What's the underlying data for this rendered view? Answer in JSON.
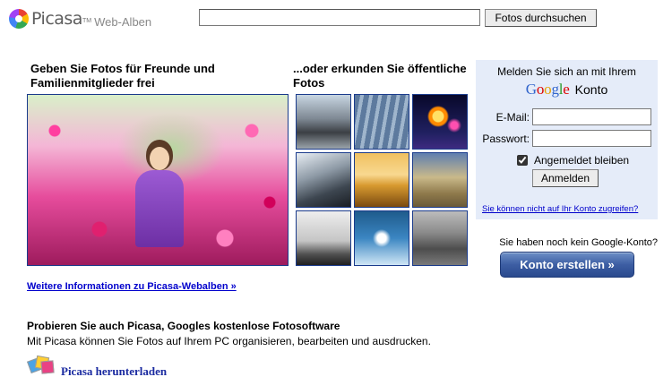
{
  "header": {
    "logo_word": "Picasa",
    "logo_tm": "TM",
    "logo_sub": "Web-Alben",
    "search_value": "",
    "search_button": "Fotos durchsuchen"
  },
  "share": {
    "heading": "Geben Sie Fotos für Freunde und Familienmitglieder frei",
    "more_link": "Weitere Informationen zu Picasa-Webalben »"
  },
  "explore": {
    "heading": "...oder erkunden Sie öffentliche Fotos"
  },
  "login": {
    "title": "Melden Sie sich an mit Ihrem",
    "google": [
      "G",
      "o",
      "o",
      "g",
      "l",
      "e"
    ],
    "konto": "Konto",
    "email_label": "E-Mail:",
    "email_value": "",
    "password_label": "Passwort:",
    "password_value": "",
    "remember_label": "Angemeldet bleiben",
    "remember_checked": true,
    "signin_button": "Anmelden",
    "cant_access_link": "Sie können nicht auf Ihr Konto zugreifen?"
  },
  "signup": {
    "question": "Sie haben noch kein Google-Konto?",
    "button": "Konto erstellen »"
  },
  "promo": {
    "heading": "Probieren Sie auch Picasa, Googles kostenlose Fotosoftware",
    "description": "Mit Picasa können Sie Fotos auf Ihrem PC organisieren, bearbeiten und ausdrucken.",
    "download_link": "Picasa herunterladen"
  },
  "colors": {
    "link": "#0000cc",
    "login_bg": "#e5ecf9",
    "create_button": "#3d5ea3",
    "thumb_border": "#1a3b8c"
  }
}
